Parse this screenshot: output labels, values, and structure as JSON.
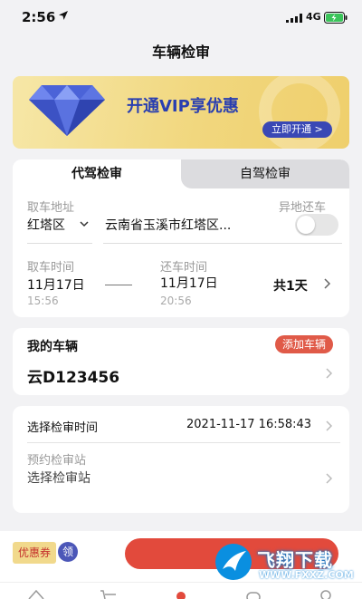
{
  "status_bar": {
    "time": "2:56",
    "network": "4G"
  },
  "nav": {
    "title": "车辆检审"
  },
  "vip_banner": {
    "text": "开通VIP享优惠",
    "button_label": "立即开通 >"
  },
  "tabs": [
    {
      "label": "代驾检审",
      "active": true
    },
    {
      "label": "自驾检审",
      "active": false
    }
  ],
  "pickup": {
    "label": "取车地址",
    "district": "红塔区",
    "address": "云南省玉溪市红塔区...",
    "return_elsewhere_label": "异地还车",
    "return_elsewhere_enabled": false
  },
  "times": {
    "pickup_label": "取车时间",
    "pickup_date": "11月17日",
    "pickup_time": "15:56",
    "return_label": "还车时间",
    "return_date": "11月17日",
    "return_time": "20:56",
    "duration": "共1天"
  },
  "vehicle": {
    "title": "我的车辆",
    "add_label": "添加车辆",
    "plate": "云D123456"
  },
  "inspection": {
    "time_label": "选择检审时间",
    "time_value": "2021-11-17 16:58:43",
    "station_label": "预约检审站",
    "station_placeholder": "选择检审站"
  },
  "bottom": {
    "coupon_label": "优惠券",
    "claim_label": "领"
  },
  "watermark": {
    "text": "飞翔下载",
    "url": "WWW.FXXZ.COM"
  },
  "colors": {
    "accent_red": "#e24a3c",
    "vip_blue": "#3a48b5",
    "vip_gold": "#f1d77e"
  }
}
